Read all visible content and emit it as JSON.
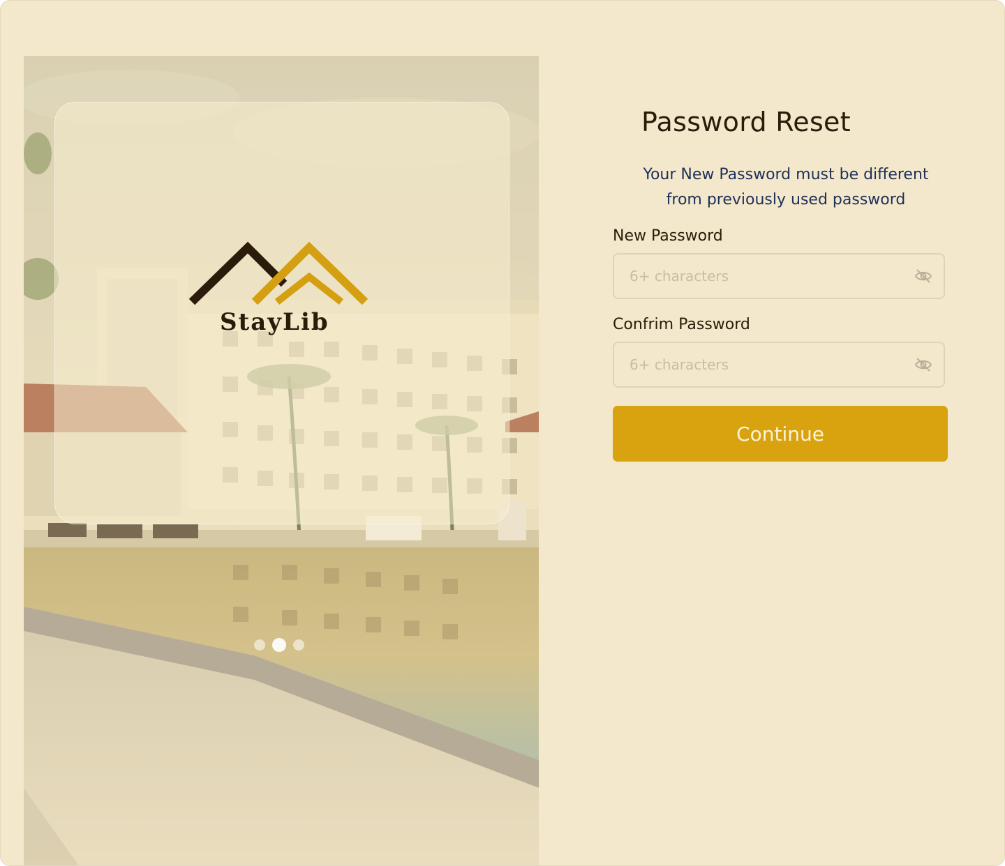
{
  "brand": {
    "name": "StayLib",
    "colors": {
      "dark": "#2a1b0a",
      "gold": "#d4a011"
    }
  },
  "carousel": {
    "slides": 3,
    "active_index": 1
  },
  "form": {
    "title": "Password Reset",
    "subtitle_line1": "Your New Password must be different",
    "subtitle_line2": "from previously used password",
    "new_password": {
      "label": "New Password",
      "placeholder": "6+ characters",
      "value": "",
      "icon": "eye-off-icon"
    },
    "confirm_password": {
      "label": "Confrim Password",
      "placeholder": "6+ characters",
      "value": "",
      "icon": "eye-off-icon"
    },
    "continue_label": "Continue"
  },
  "colors": {
    "background": "#f3e8cb",
    "accent": "#d9a20f",
    "button_text": "#fbf3d9",
    "subtitle": "#1f2f5a",
    "field_border": "#ddd3b6",
    "placeholder": "#c6bda8"
  }
}
